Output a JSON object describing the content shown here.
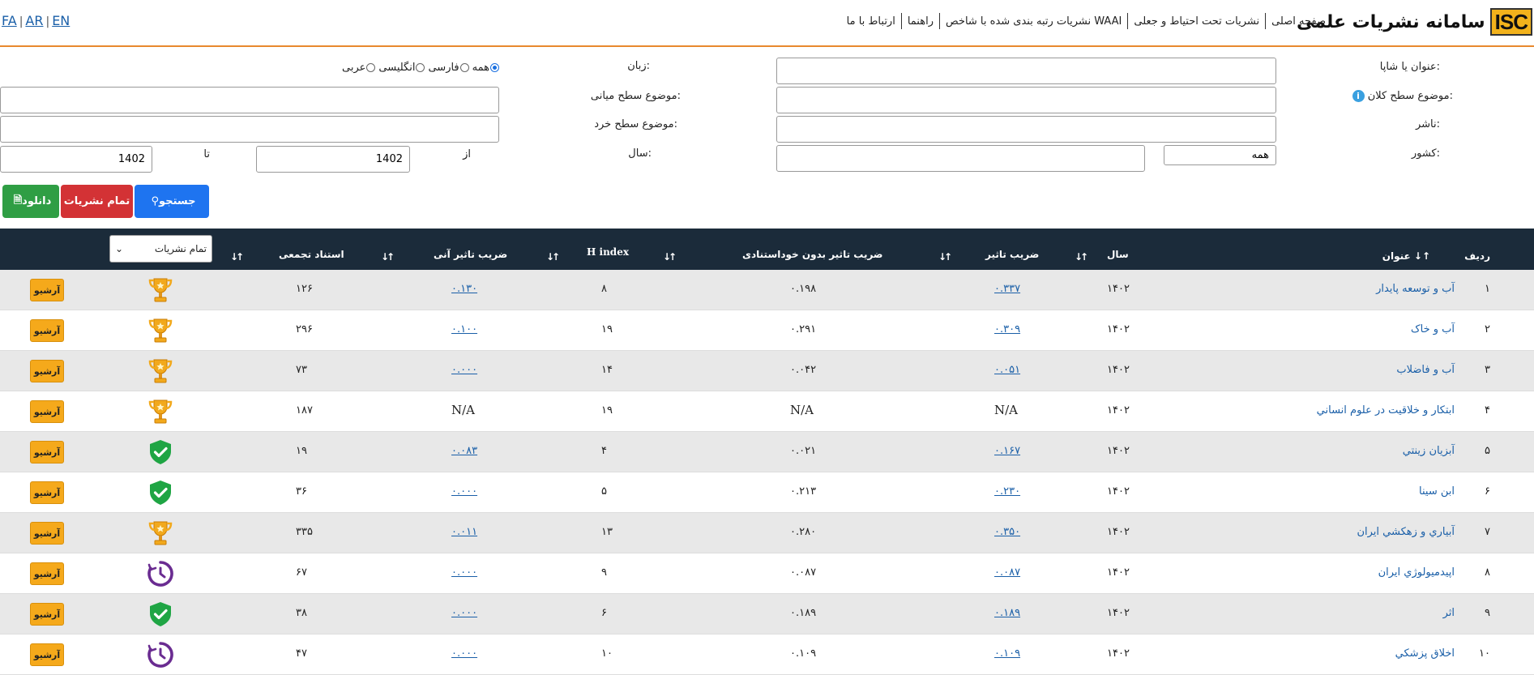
{
  "header": {
    "logo_text": "ISC",
    "site_title": "سامانه نشریات علمی",
    "nav": [
      "صفحه اصلی",
      "نشریات تحت احتیاط و جعلی",
      "نشریات رتبه بندی شده با شاخص WAAI",
      "راهنما",
      "ارتباط با ما"
    ],
    "langs": [
      "FA",
      "AR",
      "EN"
    ],
    "accent_color": "#e8892e"
  },
  "form": {
    "title_label": "عنوان یا شاپا:",
    "language_label": "زبان:",
    "language_options": [
      "همه",
      "فارسی",
      "انگلیسی",
      "عربی"
    ],
    "language_selected": "همه",
    "macro_subject_label": "موضوع سطح کلان:",
    "mid_subject_label": "موضوع سطح میانی:",
    "publisher_label": "ناشر:",
    "micro_subject_label": "موضوع سطح خرد:",
    "country_label": "کشور:",
    "country_value": "همه",
    "year_label": "سال:",
    "from_label": "از",
    "to_label": "تا",
    "year_from": "1402",
    "year_to": "1402",
    "search_button": "جستجو",
    "all_button": "تمام نشریات",
    "download_button": "دانلود"
  },
  "table": {
    "columns": {
      "index": "ردیف",
      "title": "عنوان",
      "year": "سال",
      "impact": "ضریب تاثیر",
      "impact_no_self": "ضریب تاثیر بدون خوداستنادی",
      "hindex": "H index",
      "immediacy": "ضریب تاثیر آنی",
      "citations": "استناد تجمعی"
    },
    "filter_value": "تمام نشریات",
    "archive_label": "آرشیو",
    "rows": [
      {
        "index": "۱",
        "title": "آب و توسعه پایدار",
        "year": "۱۴۰۲",
        "impact": "۰.۳۳۷",
        "impact_no_self": "۰.۱۹۸",
        "hindex": "۸",
        "immediacy": "۰.۱۳۰",
        "citations": "۱۲۶",
        "badge": "trophy"
      },
      {
        "index": "۲",
        "title": "آب و خاک",
        "year": "۱۴۰۲",
        "impact": "۰.۳۰۹",
        "impact_no_self": "۰.۲۹۱",
        "hindex": "۱۹",
        "immediacy": "۰.۱۰۰",
        "citations": "۲۹۶",
        "badge": "trophy"
      },
      {
        "index": "۳",
        "title": "آب و فاضلاب",
        "year": "۱۴۰۲",
        "impact": "۰.۰۵۱",
        "impact_no_self": "۰.۰۴۲",
        "hindex": "۱۴",
        "immediacy": "۰.۰۰۰",
        "citations": "۷۳",
        "badge": "trophy"
      },
      {
        "index": "۴",
        "title": "ابتکار و خلاقیت در علوم انساني",
        "year": "۱۴۰۲",
        "impact": "N/A",
        "impact_no_self": "N/A",
        "hindex": "۱۹",
        "immediacy": "N/A",
        "citations": "۱۸۷",
        "badge": "trophy"
      },
      {
        "index": "۵",
        "title": "آبزیان زينتي",
        "year": "۱۴۰۲",
        "impact": "۰.۱۶۷",
        "impact_no_self": "۰.۰۲۱",
        "hindex": "۴",
        "immediacy": "۰.۰۸۳",
        "citations": "۱۹",
        "badge": "shield"
      },
      {
        "index": "۶",
        "title": "ابن سینا",
        "year": "۱۴۰۲",
        "impact": "۰.۲۳۰",
        "impact_no_self": "۰.۲۱۳",
        "hindex": "۵",
        "immediacy": "۰.۰۰۰",
        "citations": "۳۶",
        "badge": "shield"
      },
      {
        "index": "۷",
        "title": "آبیاري و زهکشي ایران",
        "year": "۱۴۰۲",
        "impact": "۰.۳۵۰",
        "impact_no_self": "۰.۲۸۰",
        "hindex": "۱۳",
        "immediacy": "۰.۰۱۱",
        "citations": "۳۳۵",
        "badge": "trophy"
      },
      {
        "index": "۸",
        "title": "اپیدمیولوژي ایران",
        "year": "۱۴۰۲",
        "impact": "۰.۰۸۷",
        "impact_no_self": "۰.۰۸۷",
        "hindex": "۹",
        "immediacy": "۰.۰۰۰",
        "citations": "۶۷",
        "badge": "clock"
      },
      {
        "index": "۹",
        "title": "اثر",
        "year": "۱۴۰۲",
        "impact": "۰.۱۸۹",
        "impact_no_self": "۰.۱۸۹",
        "hindex": "۶",
        "immediacy": "۰.۰۰۰",
        "citations": "۳۸",
        "badge": "shield"
      },
      {
        "index": "۱۰",
        "title": "اخلاق پزشكي",
        "year": "۱۴۰۲",
        "impact": "۰.۱۰۹",
        "impact_no_self": "۰.۱۰۹",
        "hindex": "۱۰",
        "immediacy": "۰.۰۰۰",
        "citations": "۴۷",
        "badge": "clock"
      }
    ]
  }
}
